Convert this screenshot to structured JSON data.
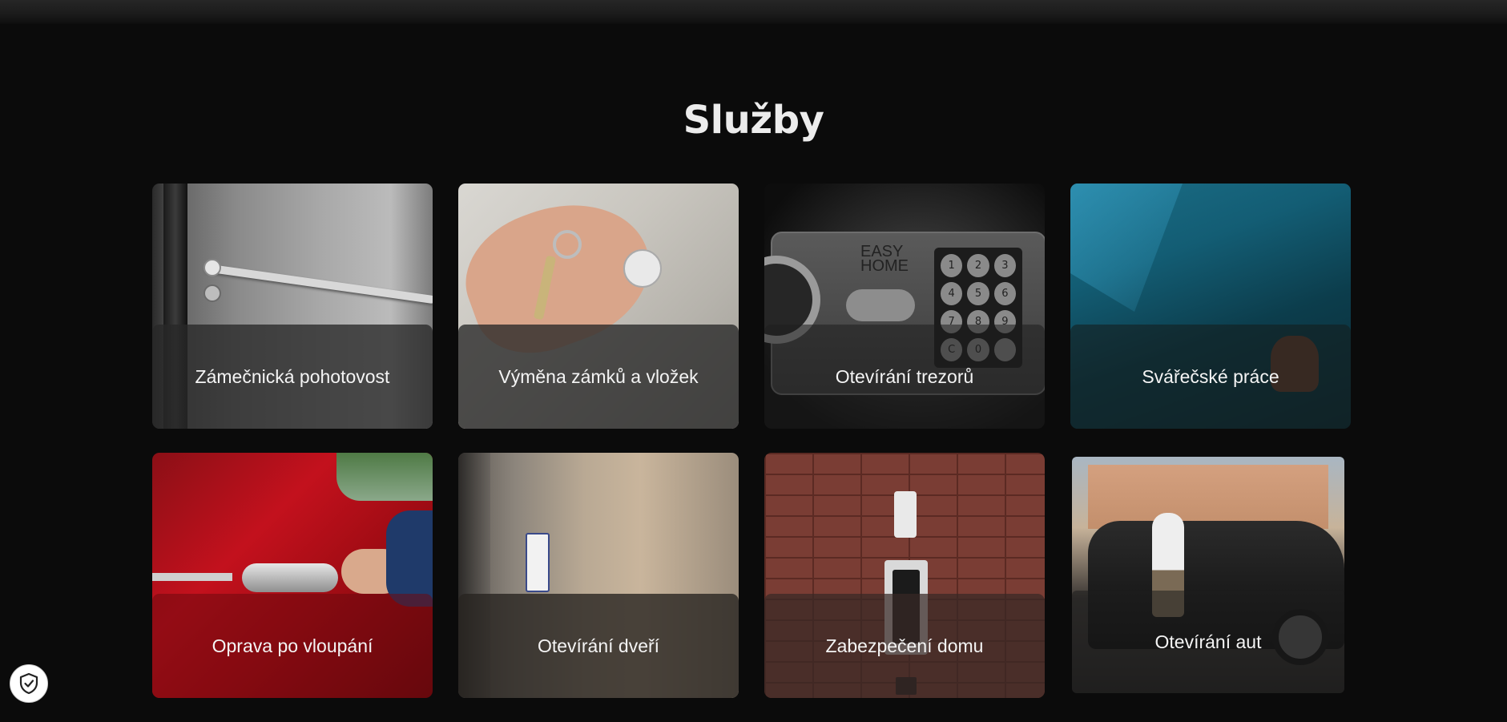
{
  "header": {
    "title": "Služby"
  },
  "services": [
    {
      "label": "Zámečnická pohotovost"
    },
    {
      "label": "Výměna zámků a vložek"
    },
    {
      "label": "Otevírání trezorů",
      "photo_text": [
        "EASY",
        "HOME"
      ],
      "keypad": [
        "1",
        "2",
        "3",
        "4",
        "5",
        "6",
        "7",
        "8",
        "9",
        "C",
        "0",
        ""
      ]
    },
    {
      "label": "Svářečské práce"
    },
    {
      "label": "Oprava po vloupání"
    },
    {
      "label": "Otevírání dveří"
    },
    {
      "label": "Zabezpečení domu"
    },
    {
      "label": "Otevírání aut"
    }
  ],
  "privacy": {
    "icon": "shield-check-icon"
  }
}
